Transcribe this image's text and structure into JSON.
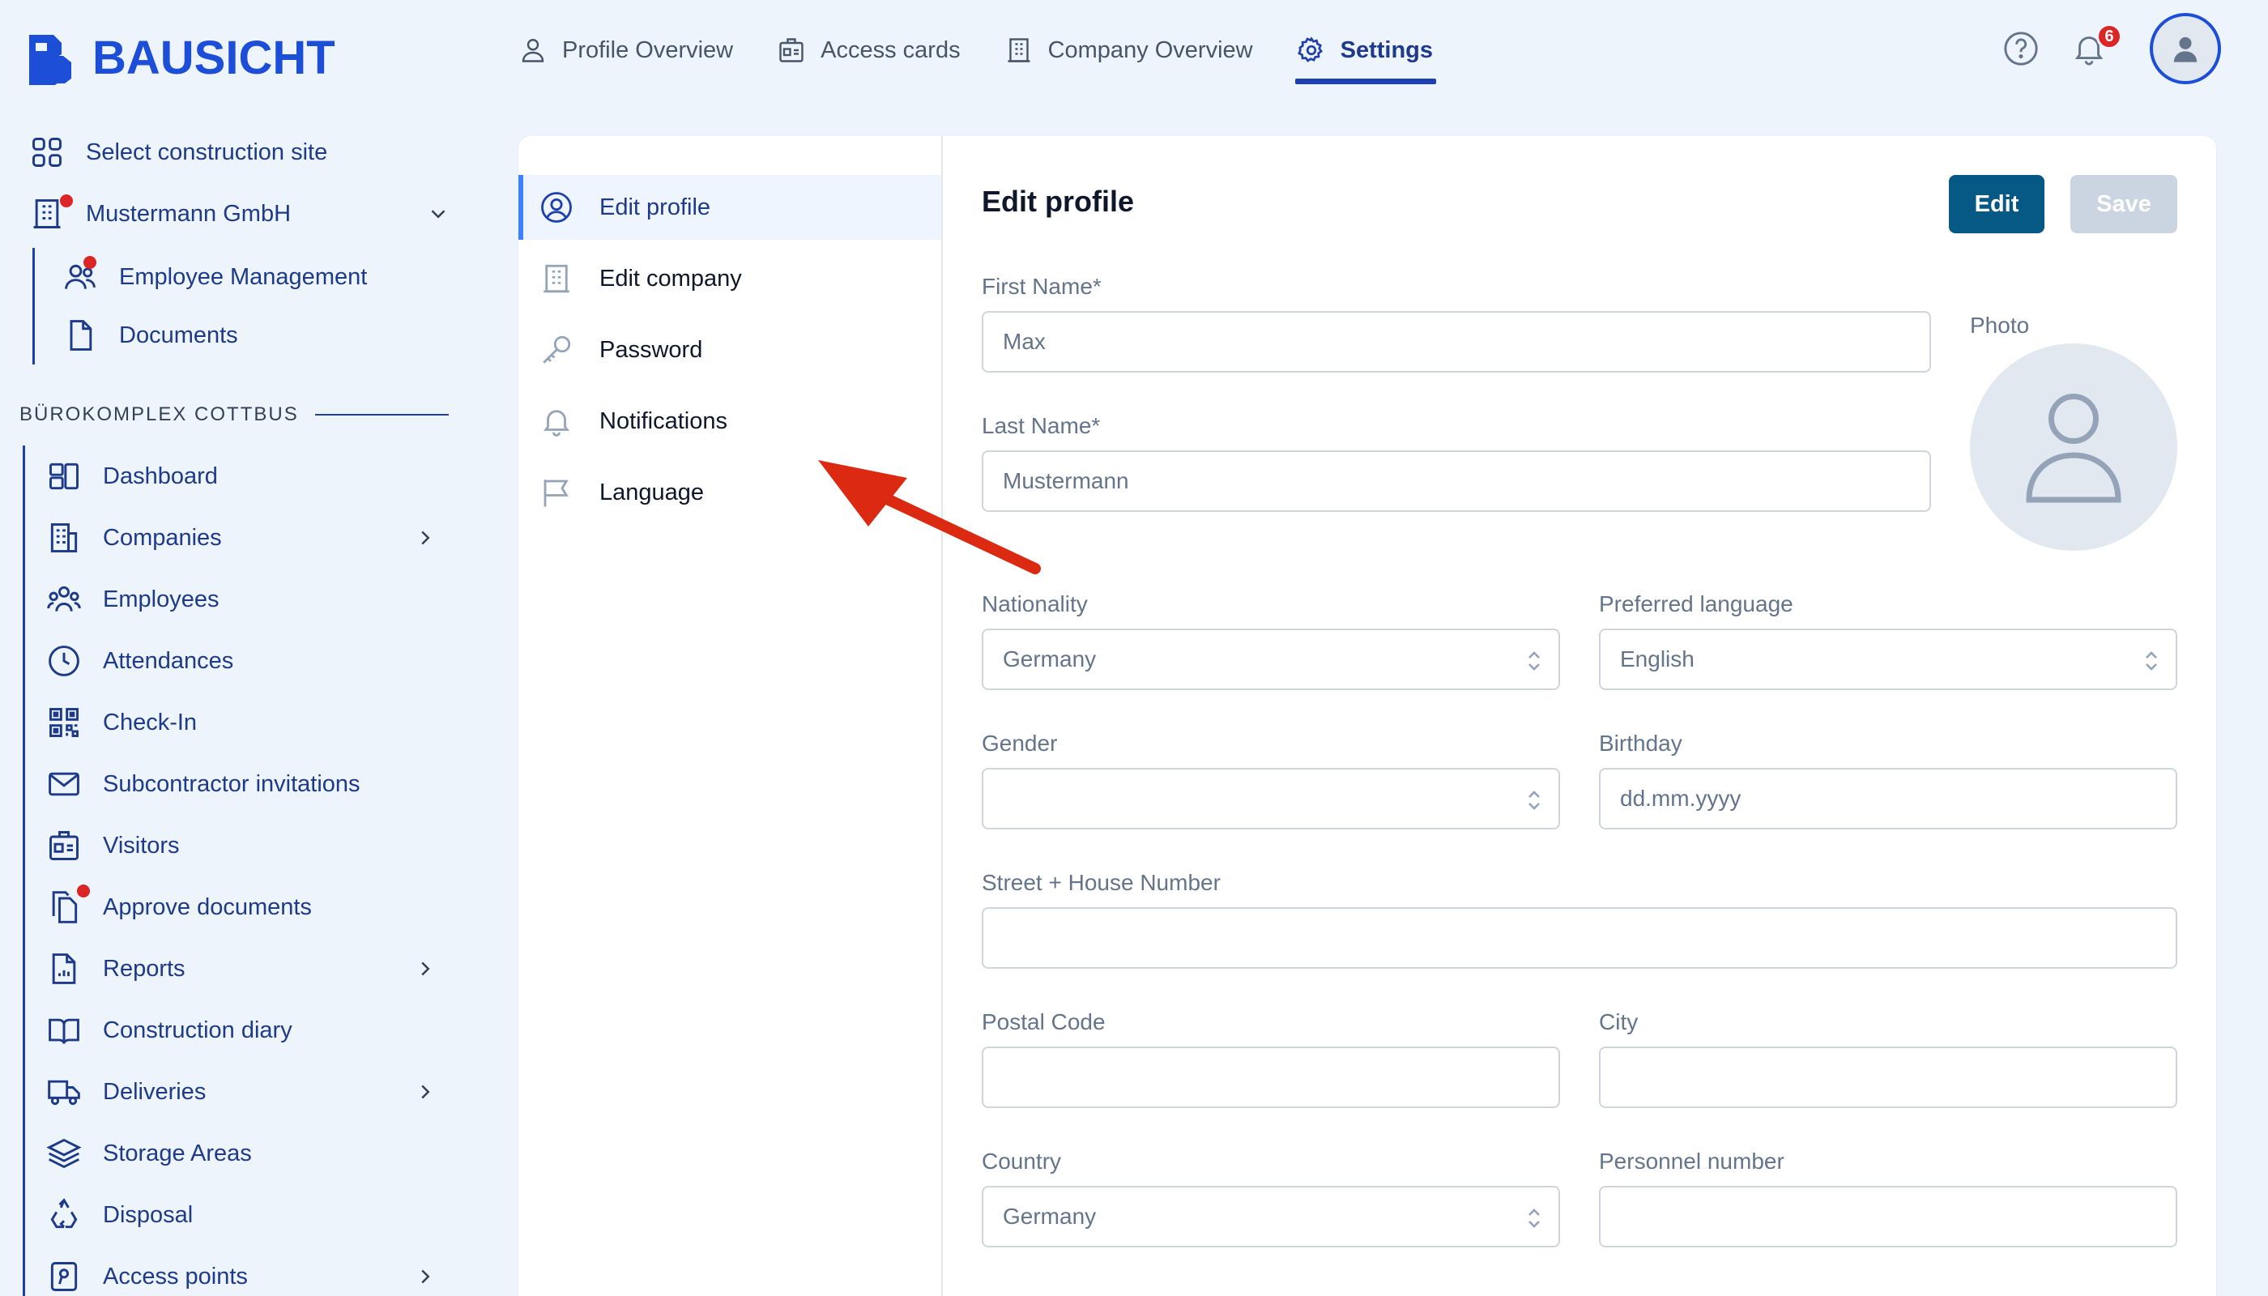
{
  "app": {
    "brand": "BAUSICHT"
  },
  "topnav": {
    "items": [
      {
        "label": "Profile Overview",
        "icon": "person-icon"
      },
      {
        "label": "Access cards",
        "icon": "id-card-icon"
      },
      {
        "label": "Company Overview",
        "icon": "building-icon"
      },
      {
        "label": "Settings",
        "icon": "gear-icon",
        "active": true
      }
    ],
    "notification_count": "6"
  },
  "sidebar": {
    "select_site": "Select construction site",
    "company": "Mustermann GmbH",
    "company_sub": [
      {
        "label": "Employee Management"
      },
      {
        "label": "Documents"
      }
    ],
    "section_title": "BÜROKOMPLEX COTTBUS",
    "nav": [
      {
        "label": "Dashboard"
      },
      {
        "label": "Companies"
      },
      {
        "label": "Employees"
      },
      {
        "label": "Attendances"
      },
      {
        "label": "Check-In"
      },
      {
        "label": "Subcontractor invitations"
      },
      {
        "label": "Visitors"
      },
      {
        "label": "Approve documents"
      },
      {
        "label": "Reports"
      },
      {
        "label": "Construction diary"
      },
      {
        "label": "Deliveries"
      },
      {
        "label": "Storage Areas"
      },
      {
        "label": "Disposal"
      },
      {
        "label": "Access points"
      }
    ]
  },
  "settings_menu": [
    {
      "label": "Edit profile",
      "active": true
    },
    {
      "label": "Edit company"
    },
    {
      "label": "Password"
    },
    {
      "label": "Notifications"
    },
    {
      "label": "Language"
    }
  ],
  "form": {
    "title": "Edit profile",
    "edit_label": "Edit",
    "save_label": "Save",
    "photo_label": "Photo",
    "first_name_label": "First Name*",
    "first_name_value": "Max",
    "last_name_label": "Last Name*",
    "last_name_value": "Mustermann",
    "nationality_label": "Nationality",
    "nationality_value": "Germany",
    "preferred_language_label": "Preferred language",
    "preferred_language_value": "English",
    "gender_label": "Gender",
    "gender_value": "",
    "birthday_label": "Birthday",
    "birthday_placeholder": "dd.mm.yyyy",
    "street_label": "Street + House Number",
    "postal_code_label": "Postal Code",
    "city_label": "City",
    "country_label": "Country",
    "country_value": "Germany",
    "personnel_number_label": "Personnel number"
  },
  "colors": {
    "brand": "#1d4ed8",
    "primary_button": "#075985",
    "badge": "#dc2626",
    "annotation_arrow": "#dc2a12"
  }
}
